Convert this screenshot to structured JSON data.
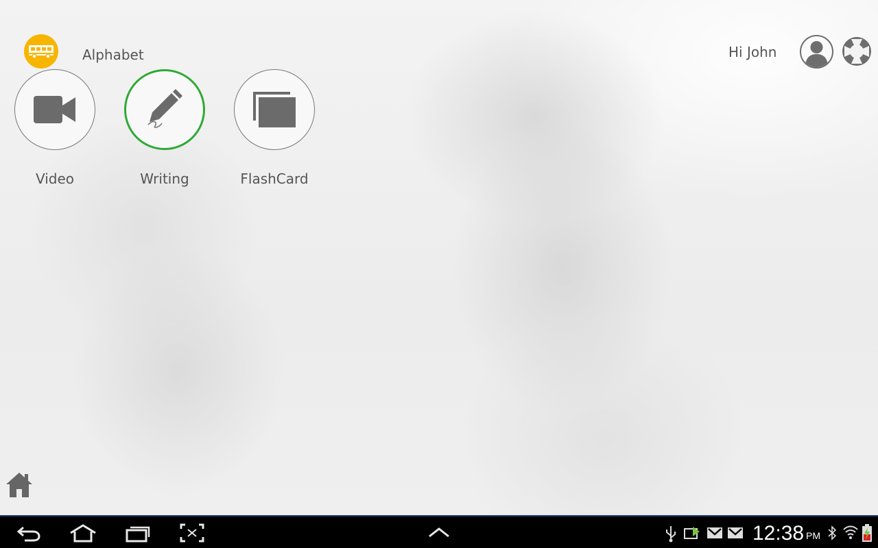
{
  "app": {
    "title": "Alphabet",
    "logo_icon": "school-bus-icon",
    "logo_color": "#f7b500"
  },
  "header": {
    "greeting": "Hi John",
    "avatar_icon": "user-avatar-icon",
    "help_icon": "lifebuoy-icon"
  },
  "menu": {
    "items": [
      {
        "label": "Video",
        "icon": "video-camera-icon",
        "active": false
      },
      {
        "label": "Writing",
        "icon": "pencil-icon",
        "active": true
      },
      {
        "label": "FlashCard",
        "icon": "flashcards-icon",
        "active": false
      }
    ],
    "active_color": "#2eaa35"
  },
  "footer": {
    "home_icon": "home-icon"
  },
  "system_bar": {
    "time": "12:38",
    "ampm": "PM",
    "nav_icons": [
      "back-icon",
      "home-nav-icon",
      "recent-apps-icon",
      "screenshot-icon",
      "chevron-up-icon"
    ],
    "status_icons": [
      "usb-icon",
      "sync-icon",
      "gmail-icon",
      "gmail-icon",
      "bluetooth-icon",
      "wifi-icon",
      "battery-charging-icon"
    ]
  }
}
